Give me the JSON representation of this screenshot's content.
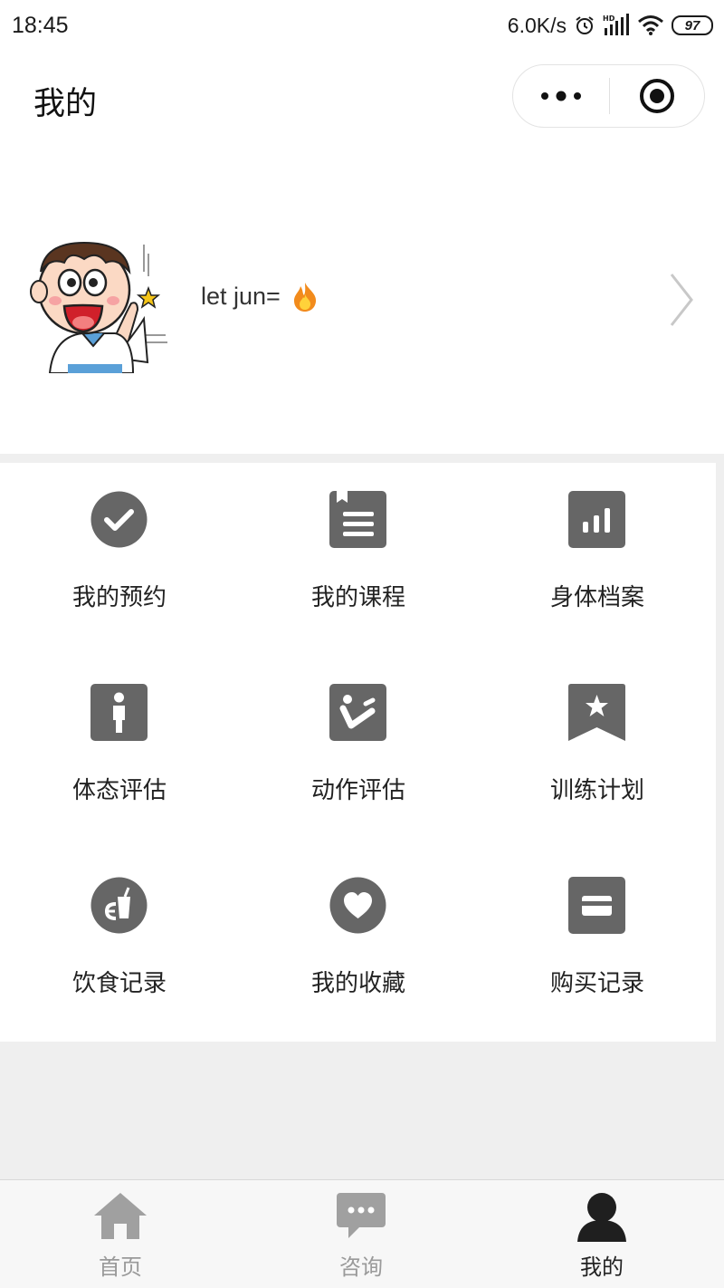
{
  "status_bar": {
    "time": "18:45",
    "network_speed": "6.0K/s",
    "battery": "97",
    "icons": [
      "alarm-icon",
      "hd-signal-icon",
      "wifi-icon",
      "battery-icon"
    ]
  },
  "nav": {
    "title": "我的",
    "capsule_icons": [
      "more-dots-icon",
      "close-target-icon"
    ]
  },
  "profile": {
    "name": "let jun=",
    "avatar_icon": "cartoon-avatar",
    "emoji_icon": "fire-icon"
  },
  "grid": {
    "items": [
      {
        "label": "我的预约",
        "icon": "check-circle-icon"
      },
      {
        "label": "我的课程",
        "icon": "notebook-icon"
      },
      {
        "label": "身体档案",
        "icon": "bar-chart-icon"
      },
      {
        "label": "体态评估",
        "icon": "person-icon"
      },
      {
        "label": "动作评估",
        "icon": "motion-icon"
      },
      {
        "label": "训练计划",
        "icon": "bookmark-star-icon"
      },
      {
        "label": "饮食记录",
        "icon": "food-drink-icon"
      },
      {
        "label": "我的收藏",
        "icon": "heart-circle-icon"
      },
      {
        "label": "购买记录",
        "icon": "card-icon"
      }
    ]
  },
  "tabs": [
    {
      "label": "首页",
      "icon": "home-icon",
      "active": false
    },
    {
      "label": "咨询",
      "icon": "chat-icon",
      "active": false
    },
    {
      "label": "我的",
      "icon": "user-icon",
      "active": true
    }
  ],
  "colors": {
    "icon_gray": "#666666",
    "tab_inactive": "#9a9a9a",
    "tab_active": "#222222",
    "background": "#efefef"
  }
}
